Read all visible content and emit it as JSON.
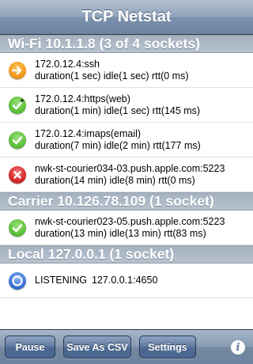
{
  "navbar": {
    "title": "TCP Netstat"
  },
  "sections": [
    {
      "header": "Wi-Fi 10.1.1.8 (3 of 4 sockets)",
      "rows": [
        {
          "icon": "orange-arrow-icon",
          "line1": "172.0.12.4:ssh",
          "line2": "duration(1 sec) idle(1 sec) rtt(0 ms)"
        },
        {
          "icon": "green-check-plus-icon",
          "line1": "172.0.12.4:https(web)",
          "line2": "duration(1 min) idle(1 sec) rtt(145 ms)"
        },
        {
          "icon": "green-check-icon",
          "line1": "172.0.12.4:imaps(email)",
          "line2": "duration(7 min) idle(2 min) rtt(177 ms)"
        },
        {
          "icon": "red-x-icon",
          "line1": "nwk-st-courier034-03.push.apple.com:5223",
          "line2": "duration(14 min) idle(8 min) rtt(0 ms)"
        }
      ]
    },
    {
      "header": "Carrier 10.126.78.109 (1 socket)",
      "rows": [
        {
          "icon": "green-check-icon",
          "line1": "nwk-st-courier023-05.push.apple.com:5223",
          "line2": "duration(13 min) idle(13 min) rtt(83 ms)"
        }
      ]
    },
    {
      "header": "Local 127.0.0.1 (1 socket)",
      "rows": [
        {
          "icon": "blue-radio-icon",
          "status": "LISTENING",
          "address": "127.0.0.1:4650"
        }
      ]
    }
  ],
  "toolbar": {
    "pause_label": "Pause",
    "csv_label": "Save As CSV",
    "settings_label": "Settings",
    "info_label": "i"
  },
  "colors": {
    "orange": "#f39a1e",
    "green": "#5cc23a",
    "red": "#d8262a",
    "blue": "#3b76d6"
  }
}
